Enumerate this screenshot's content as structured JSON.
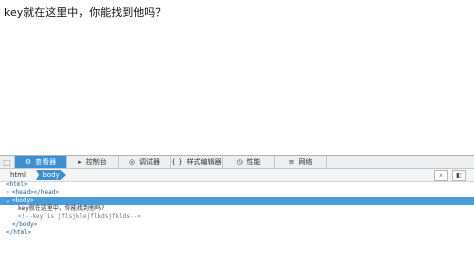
{
  "page": {
    "text": "key就在这里中，你能找到他吗？"
  },
  "devtools": {
    "tabs": [
      {
        "label": "查看器",
        "icon": "inspector-icon",
        "glyph": "⚙",
        "selected": true
      },
      {
        "label": "控制台",
        "icon": "console-icon",
        "glyph": "▸",
        "selected": false
      },
      {
        "label": "调试器",
        "icon": "debugger-icon",
        "glyph": "◎",
        "selected": false
      },
      {
        "label": "样式编辑器",
        "icon": "style-editor-icon",
        "glyph": "{ }",
        "selected": false
      },
      {
        "label": "性能",
        "icon": "performance-icon",
        "glyph": "◷",
        "selected": false
      },
      {
        "label": "网络",
        "icon": "network-icon",
        "glyph": "≡",
        "selected": false
      }
    ],
    "breadcrumbs": [
      "html",
      "body"
    ],
    "tree": {
      "html_open": "<html>",
      "head": "<head></head>",
      "body_open": "<body>",
      "body_text": "key就在这里中，你能找到他吗?",
      "comment": "<!--key is jflsjklejflkdsjfklds-->",
      "body_close": "</body>",
      "html_close": "</html>"
    },
    "colors": {
      "selected": "#3c8fd3",
      "toolbar": "#eceef0"
    }
  }
}
